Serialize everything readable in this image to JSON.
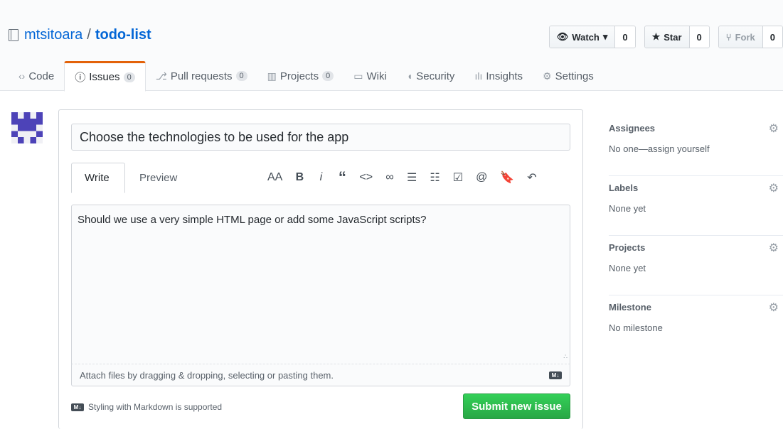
{
  "repo": {
    "owner": "mtsitoara",
    "separator": "/",
    "name": "todo-list"
  },
  "actions": {
    "watch": {
      "label": "Watch",
      "count": "0"
    },
    "star": {
      "label": "Star",
      "count": "0"
    },
    "fork": {
      "label": "Fork",
      "count": "0"
    }
  },
  "tabs": [
    {
      "label": "Code",
      "icon": "code-icon"
    },
    {
      "label": "Issues",
      "count": "0",
      "icon": "issue-icon"
    },
    {
      "label": "Pull requests",
      "count": "0",
      "icon": "pull-request-icon"
    },
    {
      "label": "Projects",
      "count": "0",
      "icon": "project-icon"
    },
    {
      "label": "Wiki",
      "icon": "book-icon"
    },
    {
      "label": "Security",
      "icon": "shield-icon"
    },
    {
      "label": "Insights",
      "icon": "graph-icon"
    },
    {
      "label": "Settings",
      "icon": "gear-icon"
    }
  ],
  "issue": {
    "title": "Choose the technologies to be used for the app",
    "write_tab": "Write",
    "preview_tab": "Preview",
    "body": "Should we use a very simple HTML page or add some JavaScript scripts?",
    "attach_text": "Attach files by dragging & dropping, selecting or pasting them.",
    "markdown_note": "Styling with Markdown is supported",
    "submit_label": "Submit new issue",
    "md_badge": "M↓"
  },
  "toolbar": [
    "AA",
    "B",
    "i",
    "“",
    "<>",
    "∞",
    "☰",
    "☷",
    "☑",
    "@",
    "🔖",
    "↶"
  ],
  "sidebar": [
    {
      "heading": "Assignees",
      "value": "No one—assign yourself"
    },
    {
      "heading": "Labels",
      "value": "None yet"
    },
    {
      "heading": "Projects",
      "value": "None yet"
    },
    {
      "heading": "Milestone",
      "value": "No milestone"
    }
  ],
  "colors": {
    "accent": "#0366d6",
    "submit": "#28a745",
    "selected_tab_border": "#e36209"
  }
}
